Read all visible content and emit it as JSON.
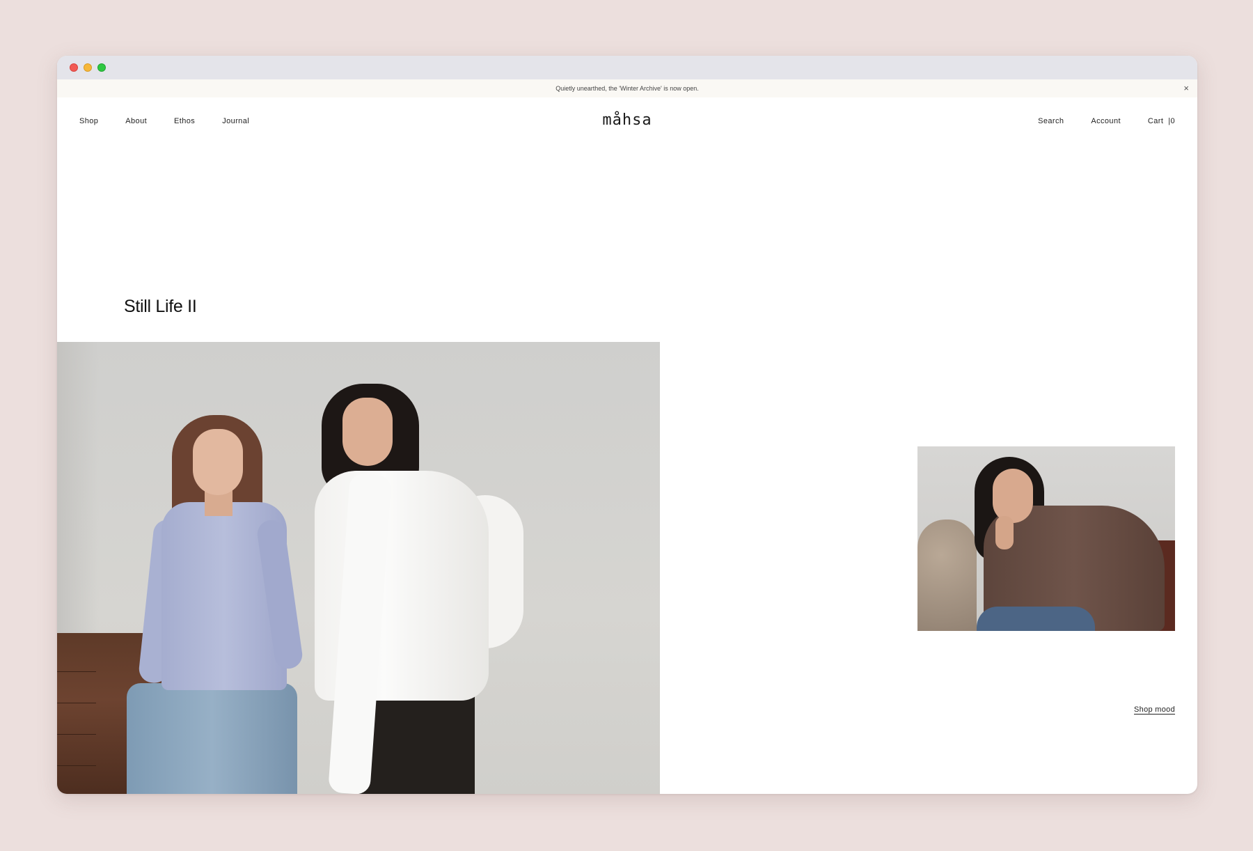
{
  "announcement": {
    "text": "Quietly unearthed, the 'Winter Archive' is now open.",
    "close_label": "×"
  },
  "nav": {
    "left": [
      "Shop",
      "About",
      "Ethos",
      "Journal"
    ],
    "logo": "måhsa",
    "right": [
      "Search",
      "Account",
      "Cart  |0"
    ]
  },
  "hero": {
    "title": "Still Life II",
    "shop_link": "Shop mood"
  },
  "colors": {
    "page_background": "#ecdfdd",
    "window": "#ffffff",
    "titlebar": "#e4e4ea",
    "announcement_bar": "#faf8f4"
  }
}
